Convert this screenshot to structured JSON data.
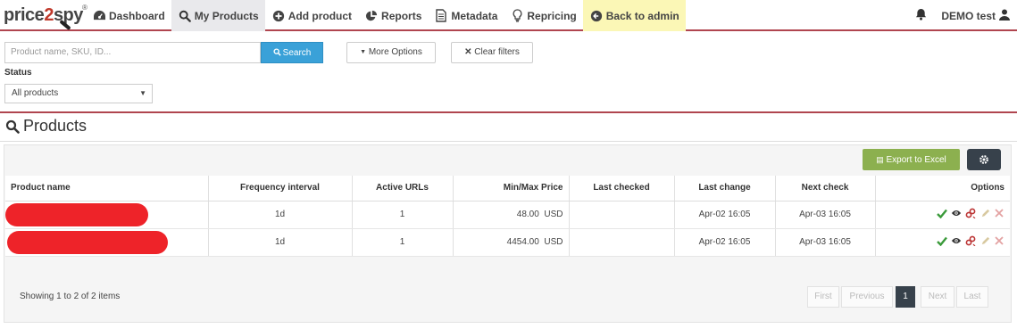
{
  "nav": {
    "logo_text": "price2spy",
    "items": [
      {
        "label": "Dashboard",
        "icon": "dashboard-icon"
      },
      {
        "label": "My Products",
        "icon": "search-icon"
      },
      {
        "label": "Add product",
        "icon": "plus-circle-icon"
      },
      {
        "label": "Reports",
        "icon": "pie-chart-icon"
      },
      {
        "label": "Metadata",
        "icon": "document-icon"
      },
      {
        "label": "Repricing",
        "icon": "lightbulb-icon"
      },
      {
        "label": "Back to admin",
        "icon": "arrow-left-circle-icon"
      }
    ],
    "user_label": "DEMO test"
  },
  "filters": {
    "search_placeholder": "Product name, SKU, ID...",
    "search_button": "Search",
    "more_options": "More Options",
    "clear_filters": "Clear filters",
    "status_label": "Status",
    "status_value": "All products"
  },
  "products": {
    "title": "Products",
    "export_label": "Export to Excel",
    "columns": [
      "Product name",
      "Frequency interval",
      "Active URLs",
      "Min/Max Price",
      "Last checked",
      "Last change",
      "Next check",
      "Options"
    ],
    "rows": [
      {
        "frequency": "1d",
        "active_urls": "1",
        "price": "48.00",
        "currency": "USD",
        "last_checked": "",
        "last_change": "Apr-02 16:05",
        "next_check": "Apr-03 16:05"
      },
      {
        "frequency": "1d",
        "active_urls": "1",
        "price": "4454.00",
        "currency": "USD",
        "last_checked": "",
        "last_change": "Apr-02 16:05",
        "next_check": "Apr-03 16:05"
      }
    ],
    "showing": "Showing 1 to 2 of 2 items",
    "pager": {
      "first": "First",
      "previous": "Previous",
      "page": "1",
      "next": "Next",
      "last": "Last"
    }
  },
  "colors": {
    "accent_red": "#b0454f",
    "search_blue": "#3aa1d8",
    "export_green": "#8cb04f",
    "dark": "#37414b",
    "admin_yellow": "#fbf7b6"
  }
}
